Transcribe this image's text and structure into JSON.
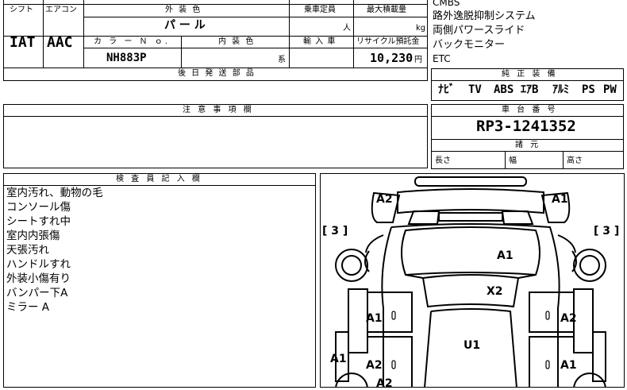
{
  "top_table": {
    "headers": {
      "shift": "シフト",
      "aircon": "エアコン",
      "exterior_color": "外 装 色",
      "capacity": "乗車定員",
      "max_load": "最大積載量",
      "color_no": "カ ラ ー Ｎ ｏ.",
      "interior_color": "内 装 色",
      "import": "輸 入 車",
      "recycle": "リサイクル預託金",
      "later_parts": "後 日 発 送 部 品"
    },
    "values": {
      "shift": "IAT",
      "aircon": "AAC",
      "exterior_color": "パ ー ル",
      "capacity_unit": "人",
      "max_load_unit": "kg",
      "color_no": "NH883P",
      "interior_color_unit": "系",
      "recycle_amount": "10,230",
      "recycle_unit": "円"
    }
  },
  "features": {
    "items": [
      "CMBS",
      "路外逸脱抑制システム",
      "両側パワースライド",
      "バックモニター",
      "ETC"
    ]
  },
  "equipment": {
    "header": "純 正 装 備",
    "items": [
      "ﾅﾋﾞ",
      "TV",
      "ABS",
      "ｴｱB",
      "ｱﾙﾐ",
      "PS",
      "PW"
    ]
  },
  "notes": {
    "header": "注 意 事 項 欄",
    "body": ""
  },
  "chassis": {
    "header": "車 台 番 号",
    "value": "RP3-1241352"
  },
  "specs": {
    "header": "諸 元",
    "length": "長さ",
    "width": "幅",
    "height": "高さ"
  },
  "inspector": {
    "header": "検 査 員 記 入 欄",
    "lines": [
      "室内汚れ、動物の毛",
      "コンソール傷",
      "シートすれ中",
      "室内内張傷",
      "天張汚れ",
      "ハンドルすれ",
      "外装小傷有り",
      "バンパー下A",
      "ミラー A"
    ]
  },
  "diagram": {
    "side_marks": {
      "left": "[ 3 ]",
      "right": "[ 3 ]"
    },
    "marks": {
      "front_left": "A2",
      "front_right": "A1",
      "hood": "A1",
      "windshield": "X2",
      "left_front_door": "A1",
      "right_front_door": "A2",
      "roof": "U1",
      "left_rear_side": "A1",
      "left_rear_door": "A2",
      "right_rear_door": "A1",
      "rear_bottom": "A2"
    }
  }
}
